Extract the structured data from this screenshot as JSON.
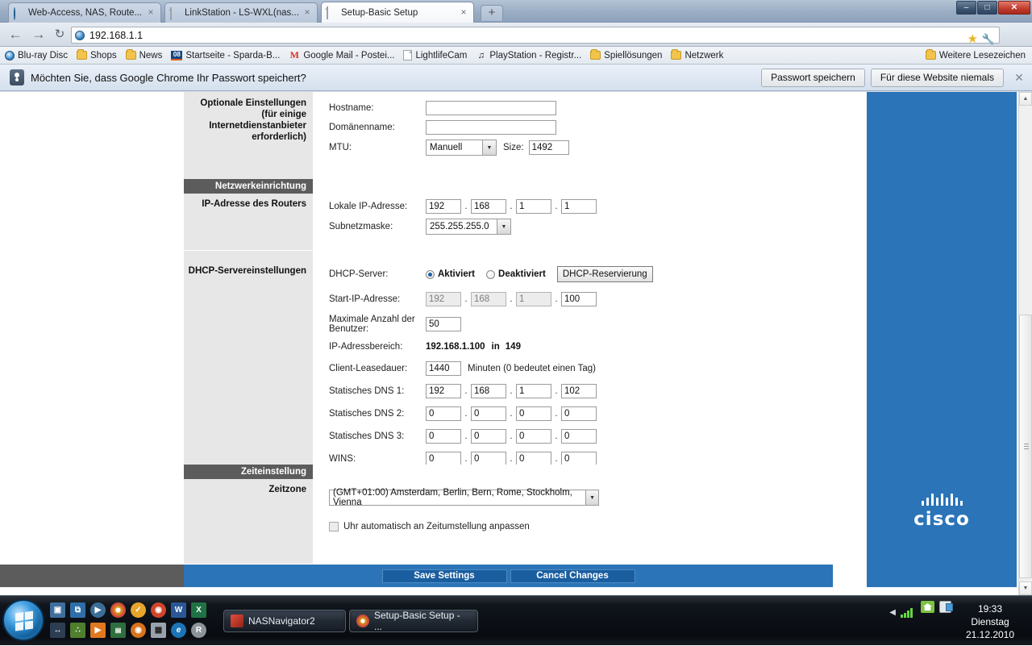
{
  "browser": {
    "tabs": [
      {
        "title": "Web-Access, NAS, Route...",
        "icon": "globe-icon",
        "active": false
      },
      {
        "title": "LinkStation - LS-WXL(nas...",
        "icon": "page-icon",
        "active": false
      },
      {
        "title": "Setup-Basic Setup",
        "icon": "page-icon",
        "active": true
      }
    ],
    "new_tab_label": "+",
    "close_label": "×",
    "window_buttons": {
      "minimize": "–",
      "maximize": "□",
      "close": "✕"
    },
    "nav": {
      "back": "←",
      "forward": "→",
      "reload": "↻"
    },
    "address": {
      "url": "192.168.1.1",
      "icon": "globe-icon"
    },
    "star_icon": "star-icon",
    "wrench_icon": "wrench-icon",
    "bookmarks": [
      {
        "label": "Blu-ray Disc",
        "icon": "bluray-icon"
      },
      {
        "label": "Shops",
        "icon": "folder-icon"
      },
      {
        "label": "News",
        "icon": "folder-icon"
      },
      {
        "label": "Startseite - Sparda-B...",
        "icon": "sparda-icon"
      },
      {
        "label": "Google Mail - Postei...",
        "icon": "gmail-icon"
      },
      {
        "label": "LightlifeCam",
        "icon": "page-icon"
      },
      {
        "label": "PlayStation - Registr...",
        "icon": "playstation-icon"
      },
      {
        "label": "Spiellösungen",
        "icon": "folder-icon"
      },
      {
        "label": "Netzwerk",
        "icon": "folder-icon"
      }
    ],
    "bookmarks_overflow": {
      "label": "Weitere Lesezeichen",
      "icon": "folder-icon"
    },
    "infobar": {
      "icon": "key-icon",
      "message": "Möchten Sie, dass Google Chrome Ihr Passwort speichert?",
      "save_button": "Passwort speichern",
      "never_button": "Für diese Website niemals",
      "close_label": "✕"
    }
  },
  "router": {
    "optional": {
      "section_label": "Optionale Einstellungen (für einige Internetdienstanbieter erforderlich)",
      "hostname_label": "Hostname:",
      "hostname_value": "",
      "domain_label": "Domänenname:",
      "domain_value": "",
      "mtu_label": "MTU:",
      "mtu_value": "Manuell",
      "size_label": "Size:",
      "size_value": "1492"
    },
    "network_setup": {
      "header": "Netzwerkeinrichtung",
      "section_label": "IP-Adresse des Routers",
      "local_ip_label": "Lokale IP-Adresse:",
      "local_ip": [
        "192",
        "168",
        "1",
        "1"
      ],
      "subnet_label": "Subnetzmaske:",
      "subnet_value": "255.255.255.0"
    },
    "dhcp": {
      "section_label": "DHCP-Servereinstellungen",
      "server_label": "DHCP-Server:",
      "enabled_label": "Aktiviert",
      "disabled_label": "Deaktiviert",
      "selected": "Aktiviert",
      "reservation_button": "DHCP-Reservierung",
      "start_ip_label": "Start-IP-Adresse:",
      "start_ip": [
        "192",
        "168",
        "1",
        "100"
      ],
      "max_users_label": "Maximale Anzahl der Benutzer:",
      "max_users_value": "50",
      "range_label": "IP-Adressbereich:",
      "range_start": "192.168.1.100",
      "range_joiner": "in",
      "range_end": "149",
      "lease_label": "Client-Leasedauer:",
      "lease_value": "1440",
      "lease_unit": "Minuten (0 bedeutet einen Tag)",
      "dns1_label": "Statisches DNS 1:",
      "dns1": [
        "192",
        "168",
        "1",
        "102"
      ],
      "dns2_label": "Statisches DNS 2:",
      "dns2": [
        "0",
        "0",
        "0",
        "0"
      ],
      "dns3_label": "Statisches DNS 3:",
      "dns3": [
        "0",
        "0",
        "0",
        "0"
      ],
      "wins_label": "WINS:",
      "wins": [
        "0",
        "0",
        "0",
        "0"
      ]
    },
    "time": {
      "header": "Zeiteinstellung",
      "section_label": "Zeitzone",
      "timezone_value": "(GMT+01:00) Amsterdam, Berlin, Bern, Rome, Stockholm, Vienna",
      "dst_label": "Uhr automatisch an Zeitumstellung anpassen",
      "dst_checked": false
    },
    "footer": {
      "save": "Save Settings",
      "cancel": "Cancel Changes"
    },
    "brand": {
      "name": "cisco",
      "logo": "cisco-logo"
    },
    "colors": {
      "accent": "#2b74b8",
      "header_grey": "#5c5c5c",
      "panel_grey": "#e7e7e7"
    }
  },
  "taskbar": {
    "start_label": "Start",
    "quick_launch": [
      {
        "name": "show-desktop-icon",
        "glyph": "▣",
        "color": "#3f6e9e"
      },
      {
        "name": "switch-windows-icon",
        "glyph": "⧉",
        "color": "#2f6ea8"
      },
      {
        "name": "media-player-icon",
        "glyph": "▶",
        "color": "#3b6e96"
      },
      {
        "name": "chrome-icon",
        "glyph": "●",
        "color": "#d9a21b"
      },
      {
        "name": "shield-icon",
        "glyph": "✓",
        "color": "#e8a52b"
      },
      {
        "name": "firefox-icon",
        "glyph": "◉",
        "color": "#d1452a"
      },
      {
        "name": "word-icon",
        "glyph": "W",
        "color": "#2b5797"
      },
      {
        "name": "excel-icon",
        "glyph": "X",
        "color": "#1f7244"
      },
      {
        "name": "hamachi-icon",
        "glyph": "↔",
        "color": "#2d3d52"
      },
      {
        "name": "network-icon",
        "glyph": "∴",
        "color": "#4f7f2d"
      },
      {
        "name": "vlc-icon",
        "glyph": "▶",
        "color": "#e07820"
      },
      {
        "name": "truecrypt-icon",
        "glyph": "▤",
        "color": "#2e6e3f"
      },
      {
        "name": "firefox2-icon",
        "glyph": "◉",
        "color": "#d9721b"
      },
      {
        "name": "calculator-icon",
        "glyph": "▦",
        "color": "#9aa3ad"
      },
      {
        "name": "ie-icon",
        "glyph": "e",
        "color": "#1b74b8"
      },
      {
        "name": "r-icon",
        "glyph": "R",
        "color": "#8d939b"
      }
    ],
    "windows": [
      {
        "label": "NASNavigator2",
        "icon": "nasnavigator-icon",
        "color": "#c0392b",
        "active": false
      },
      {
        "label": "Setup-Basic Setup - ...",
        "icon": "chrome-icon",
        "color": "#d9a21b",
        "active": true
      }
    ],
    "tray": {
      "show_hidden": "◀",
      "signal_icon": "signal-icon",
      "home_icon": "home-icon",
      "plug_icon": "plug-icon",
      "time": "19:33",
      "weekday": "Dienstag",
      "date": "21.12.2010"
    }
  }
}
